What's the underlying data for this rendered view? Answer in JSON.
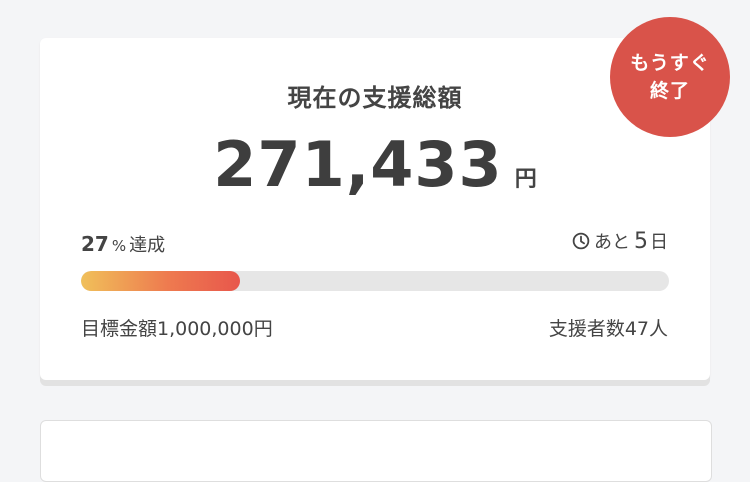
{
  "funding": {
    "title": "現在の支援総額",
    "amount": "271,433",
    "currency": "円",
    "achieved_number": "27",
    "percent_sign": "%",
    "achieved_label": "達成",
    "progress_percent": 27,
    "remaining_prefix": "あと",
    "remaining_days": "5",
    "remaining_unit": "日",
    "goal_text": "目標金額1,000,000円",
    "supporters_text": "支援者数47人",
    "badge_line1": "もうすぐ",
    "badge_line2": "終了"
  },
  "colors": {
    "badge": "#d9534a",
    "bar_start": "#f0c05a",
    "bar_end": "#e8574c",
    "bar_track": "#e6e6e6"
  },
  "icons": {
    "remaining": "clock-icon"
  }
}
